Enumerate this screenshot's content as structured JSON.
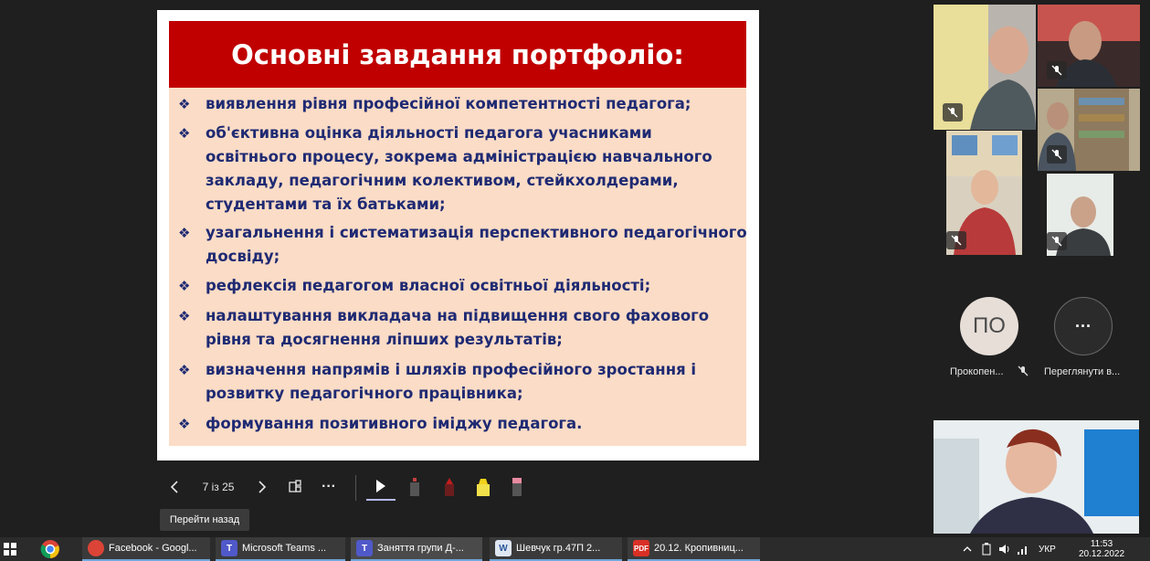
{
  "slide": {
    "title": "Основні завдання  портфоліо:",
    "bullet_mark": "❖",
    "bullets": [
      "виявлення рівня професійної компетентності педагога;",
      "об'єктивна оцінка діяльності педагога учасниками освітнього процесу, зокрема адміністрацією навчального закладу, педагогічним колективом, стейкхолдерами, студентами та їх батьками;",
      "узагальнення і систематизація перспективного педагогічного досвіду;",
      "рефлексія педагогом власної освітньої діяльності;",
      "налаштування викладача на підвищення свого фахового рівня та досягнення ліпших результатів;",
      "визначення напрямів і шляхів професійного зростання і розвитку педагогічного працівника;",
      "формування позитивного іміджу педагога."
    ],
    "colors": {
      "title_bg": "#c00000",
      "body_bg": "#fbdcc6",
      "text": "#1f2a73"
    }
  },
  "controls": {
    "page_indicator": "7 із 25",
    "tooltip": "Перейти назад",
    "more": "···"
  },
  "participants": {
    "avatar_initials": "ПО",
    "avatar_name": "Прокопен...",
    "view_more_label": "Переглянути в...",
    "more_glyph": "···"
  },
  "taskbar": {
    "items": [
      "Facebook - Googl...",
      "Microsoft Teams ...",
      "Заняття групи Д-...",
      "Шевчук гр.47П 2...",
      "20.12. Кропивниц..."
    ],
    "language": "УКР",
    "time": "11:53",
    "date": "20.12.2022"
  }
}
